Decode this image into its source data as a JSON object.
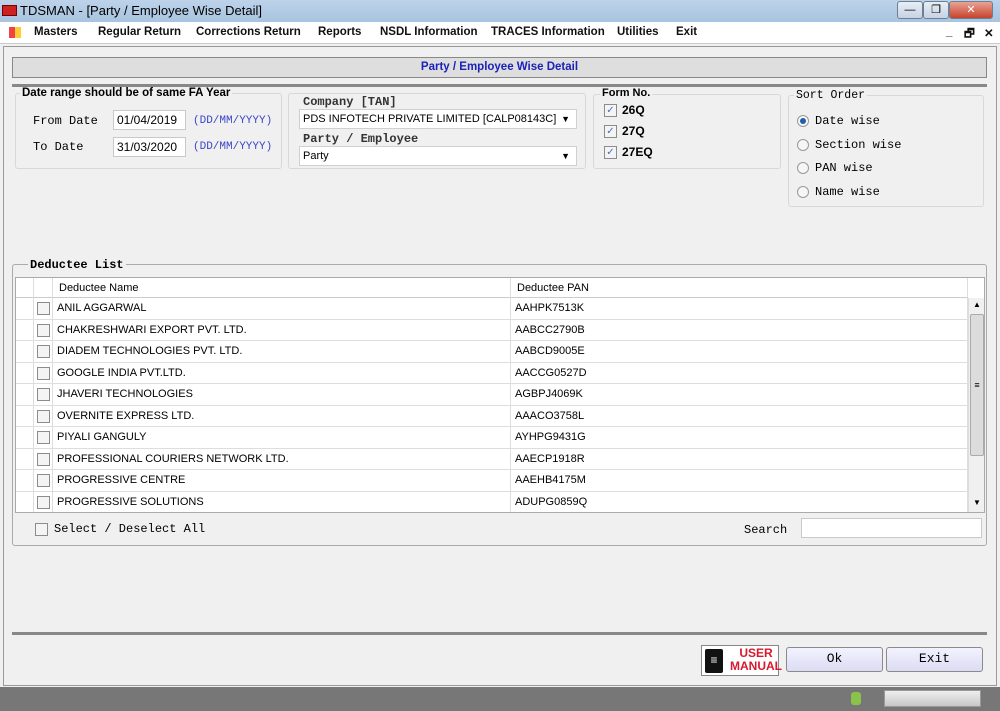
{
  "window": {
    "title": "TDSMAN - [Party / Employee Wise Detail]",
    "minimize": "—",
    "restore": "❐",
    "close": "✕"
  },
  "menu": {
    "items": [
      "Masters",
      "Regular Return",
      "Corrections Return",
      "Reports",
      "NSDL Information",
      "TRACES Information",
      "Utilities",
      "Exit"
    ],
    "right": [
      "_",
      "🗗",
      "✕"
    ]
  },
  "header": {
    "title": "Party / Employee Wise Detail"
  },
  "date_range": {
    "title": "Date range should be of same FA Year",
    "from_label": "From Date",
    "from_value": "01/04/2019",
    "to_label": "To Date",
    "to_value": "31/03/2020",
    "format_hint": "(DD/MM/YYYY)"
  },
  "company": {
    "label": "Company [TAN]",
    "value": "PDS INFOTECH PRIVATE LIMITED [CALP08143C]",
    "party_label": "Party / Employee",
    "party_value": "Party"
  },
  "form_no": {
    "title": "Form No.",
    "items": [
      {
        "label": "26Q",
        "checked": true
      },
      {
        "label": "27Q",
        "checked": true
      },
      {
        "label": "27EQ",
        "checked": true
      }
    ]
  },
  "sort_order": {
    "title": "Sort Order",
    "options": [
      {
        "label": "Date wise",
        "selected": true
      },
      {
        "label": "Section wise",
        "selected": false
      },
      {
        "label": "PAN wise",
        "selected": false
      },
      {
        "label": "Name wise",
        "selected": false
      }
    ]
  },
  "deductee_list": {
    "title": "Deductee List",
    "columns": [
      "Deductee Name",
      "Deductee PAN"
    ],
    "rows": [
      [
        "ANIL AGGARWAL",
        "AAHPK7513K"
      ],
      [
        "CHAKRESHWARI EXPORT PVT. LTD.",
        "AABCC2790B"
      ],
      [
        "DIADEM TECHNOLOGIES PVT. LTD.",
        "AABCD9005E"
      ],
      [
        "GOOGLE INDIA PVT.LTD.",
        "AACCG0527D"
      ],
      [
        "JHAVERI TECHNOLOGIES",
        "AGBPJ4069K"
      ],
      [
        "OVERNITE EXPRESS LTD.",
        "AAACO3758L"
      ],
      [
        "PIYALI GANGULY",
        "AYHPG9431G"
      ],
      [
        "PROFESSIONAL COURIERS NETWORK LTD.",
        "AAECP1918R"
      ],
      [
        "PROGRESSIVE CENTRE",
        "AAEHB4175M"
      ],
      [
        "PROGRESSIVE SOLUTIONS",
        "ADUPG0859Q"
      ]
    ],
    "select_all": "Select / Deselect All",
    "search_label": "Search",
    "search_value": ""
  },
  "footer": {
    "user_manual_line1": "USER",
    "user_manual_line2": "MANUAL",
    "ok": "Ok",
    "exit": "Exit"
  },
  "colors": {
    "accent": "#1a22b8",
    "hint": "#3b46c8",
    "manual": "#d9182d"
  }
}
